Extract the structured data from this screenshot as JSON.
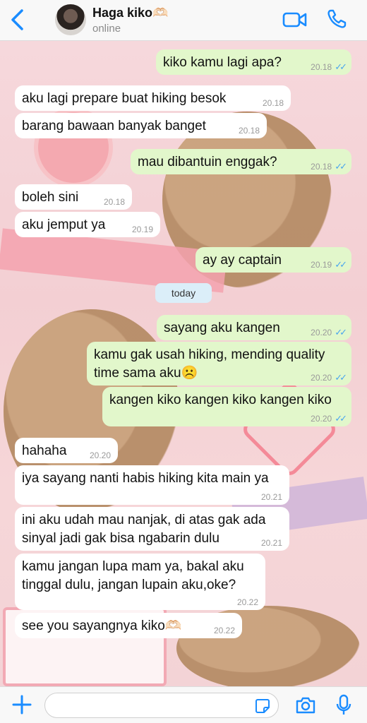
{
  "header": {
    "name": "Haga kiko🫶🏻",
    "status": "online"
  },
  "messages": [
    {
      "dir": "out",
      "text": "kiko kamu lagi apa?",
      "time": "20.18",
      "read": true
    },
    {
      "dir": "in",
      "text": "aku lagi prepare buat hiking besok",
      "time": "20.18"
    },
    {
      "dir": "in",
      "text": "barang bawaan banyak banget",
      "time": "20.18"
    },
    {
      "dir": "out",
      "text": "mau dibantuin enggak?",
      "time": "20.18",
      "read": true
    },
    {
      "dir": "in",
      "text": "boleh sini",
      "time": "20.18"
    },
    {
      "dir": "in",
      "text": "aku jemput ya",
      "time": "20.19"
    },
    {
      "dir": "out",
      "text": "ay ay captain",
      "time": "20.19",
      "read": true
    },
    {
      "dir": "out",
      "text": "sayang aku kangen",
      "time": "20.20",
      "read": true
    },
    {
      "dir": "out",
      "text": "kamu gak usah hiking, mending quality time sama aku☹️",
      "time": "20.20",
      "read": true
    },
    {
      "dir": "out",
      "text": "kangen kiko kangen kiko kangen kiko",
      "time": "20.20",
      "read": true
    },
    {
      "dir": "in",
      "text": "hahaha",
      "time": "20.20"
    },
    {
      "dir": "in",
      "text": "iya sayang nanti habis hiking kita main ya",
      "time": "20.21"
    },
    {
      "dir": "in",
      "text": "ini aku udah mau nanjak, di atas gak ada sinyal jadi gak bisa ngabarin dulu",
      "time": "20.21"
    },
    {
      "dir": "in",
      "text": "kamu jangan lupa mam ya, bakal aku tinggal dulu, jangan lupain aku,oke?",
      "time": "20.22"
    },
    {
      "dir": "in",
      "text": "see you sayangnya kiko🫶🏻",
      "time": "20.22"
    }
  ],
  "date_separator": "today",
  "composer": {
    "value": "",
    "placeholder": ""
  },
  "icons": {
    "back": "chevron-left-icon",
    "video": "video-camera-icon",
    "call": "phone-icon",
    "attach": "plus-icon",
    "sticker": "sticker-icon",
    "camera": "camera-icon",
    "mic": "microphone-icon"
  },
  "colors": {
    "accent": "#1a8cff",
    "outgoing_bubble": "#e2f7cb",
    "incoming_bubble": "#ffffff",
    "read_ticks": "#4aa6ee",
    "date_pill": "#dbeef9"
  }
}
